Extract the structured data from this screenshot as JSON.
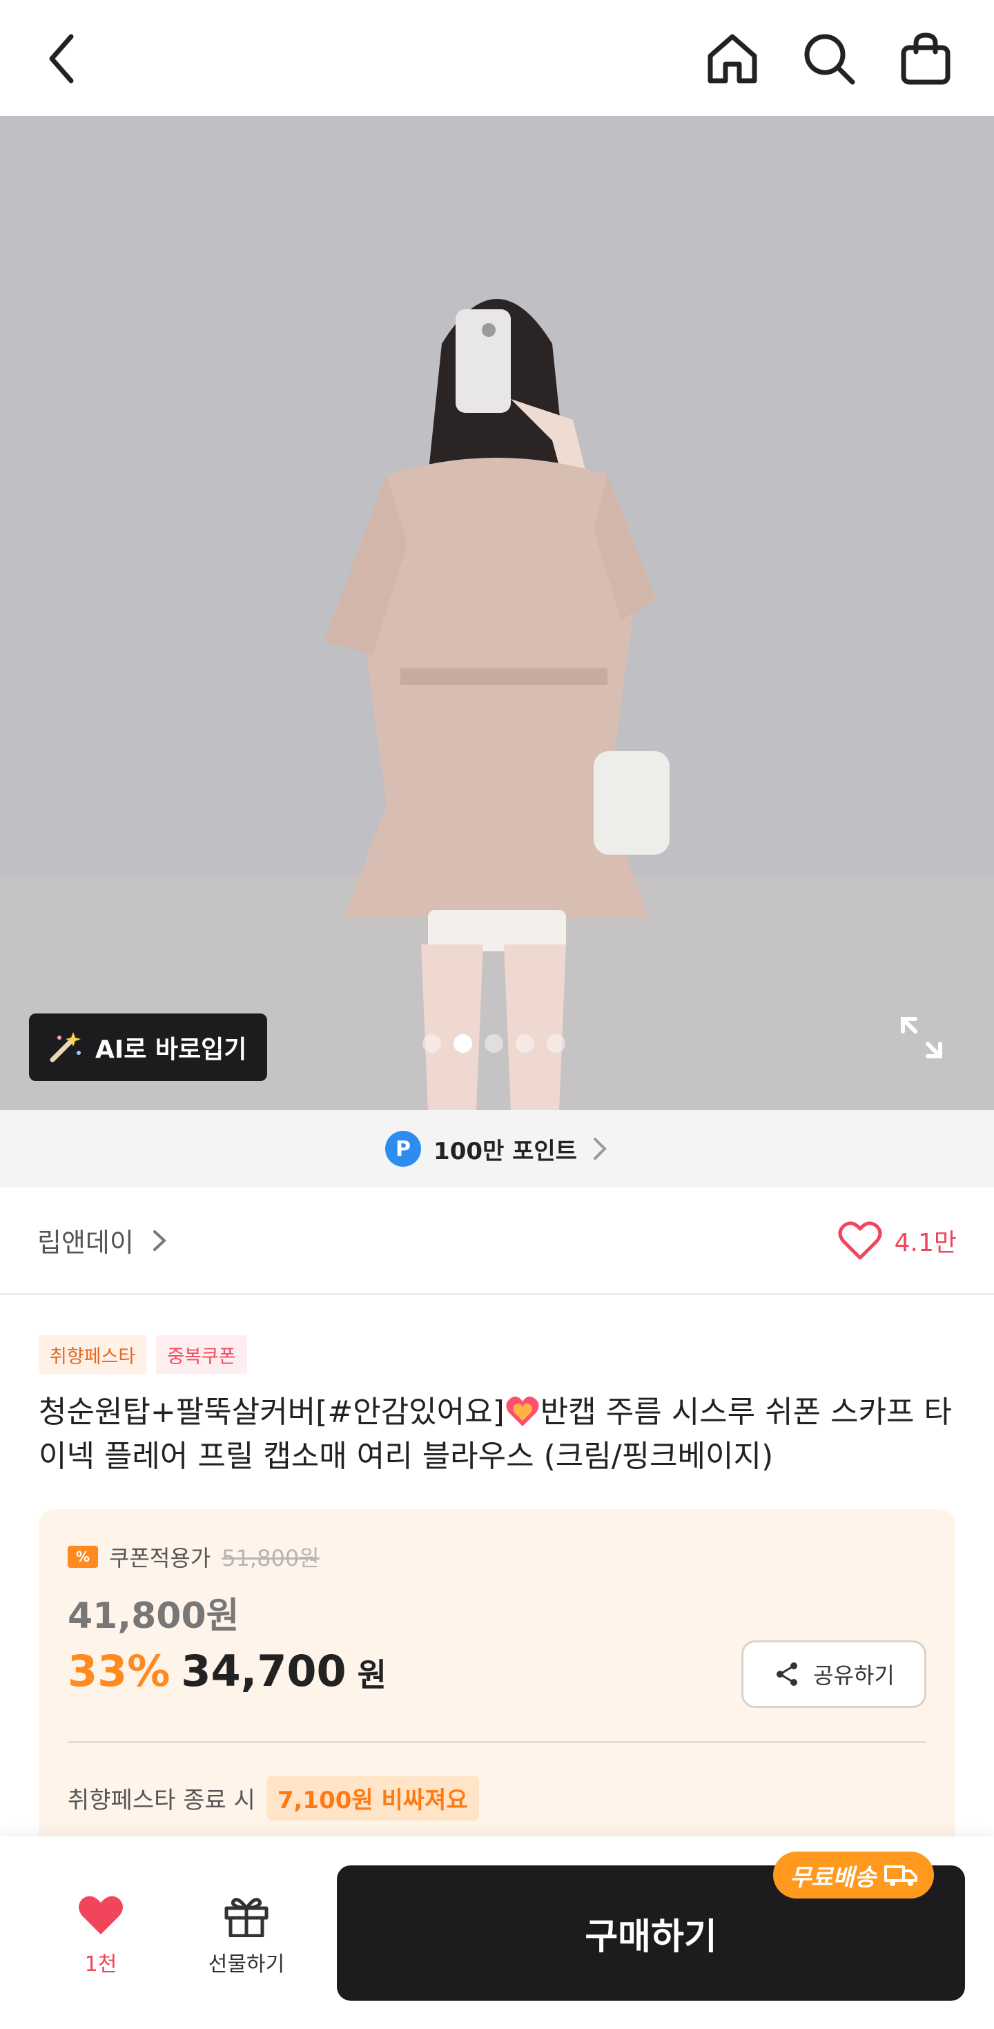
{
  "topbar": {
    "back_icon": "chevron-left-icon",
    "home_icon": "home-icon",
    "search_icon": "search-icon",
    "cart_icon": "shopping-bag-icon"
  },
  "hero": {
    "ai_button_label": "AI로 바로입기",
    "image_count": 5,
    "active_image_index": 2
  },
  "points_banner": {
    "badge": "P",
    "label": "100만 포인트"
  },
  "brand": {
    "name": "립앤데이",
    "wish_count": "4.1만"
  },
  "product": {
    "tags": [
      "취향페스타",
      "중복쿠폰"
    ],
    "title_part1": "청순원탑+팔뚝살커버[#안감있어요]",
    "title_part2": "반캡 주름 시스루 쉬폰 스카프 타이넥 플레어 프릴 캡소매 여리 블라우스 (크림/핑크베이지)"
  },
  "price": {
    "coupon_label": "쿠폰적용가",
    "original_price": "51,800원",
    "coupon_price": "41,800원",
    "discount_pct": "33%",
    "final_price": "34,700",
    "final_unit": "원",
    "share_label": "공유하기",
    "festa_end_label": "취향페스타 종료 시",
    "festa_end_badge": "7,100원 비싸져요"
  },
  "bottom": {
    "like_count": "1천",
    "gift_label": "선물하기",
    "buy_label": "구매하기",
    "free_ship_label": "무료배송"
  },
  "colors": {
    "accent_orange": "#ff8a1f",
    "heart_red": "#f0455a",
    "buy_button": "#1c1c1e"
  }
}
